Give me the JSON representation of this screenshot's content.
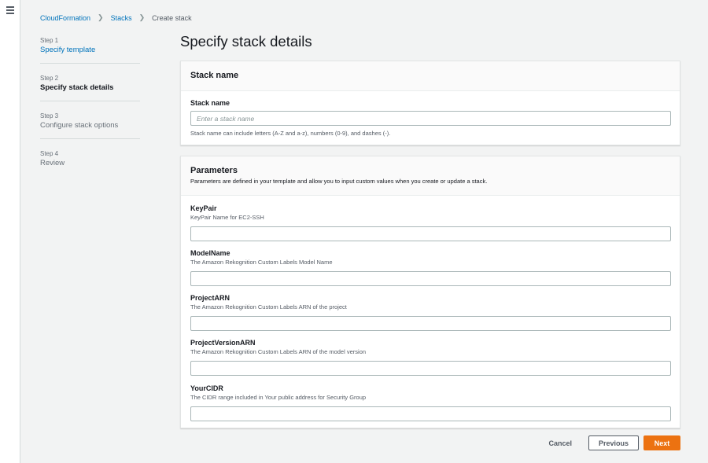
{
  "breadcrumb": {
    "items": [
      "CloudFormation",
      "Stacks"
    ],
    "current": "Create stack"
  },
  "steps": [
    {
      "num": "Step 1",
      "title": "Specify template"
    },
    {
      "num": "Step 2",
      "title": "Specify stack details"
    },
    {
      "num": "Step 3",
      "title": "Configure stack options"
    },
    {
      "num": "Step 4",
      "title": "Review"
    }
  ],
  "page_title": "Specify stack details",
  "stack_name_section": {
    "title": "Stack name",
    "field_label": "Stack name",
    "placeholder": "Enter a stack name",
    "value": "",
    "hint": "Stack name can include letters (A-Z and a-z), numbers (0-9), and dashes (-)."
  },
  "parameters_section": {
    "title": "Parameters",
    "description": "Parameters are defined in your template and allow you to input custom values when you create or update a stack.",
    "params": [
      {
        "label": "KeyPair",
        "description": "KeyPair Name for EC2-SSH",
        "value": ""
      },
      {
        "label": "ModelName",
        "description": "The Amazon Rekognition Custom Labels Model Name",
        "value": ""
      },
      {
        "label": "ProjectARN",
        "description": "The Amazon Rekognition Custom Labels ARN of the project",
        "value": ""
      },
      {
        "label": "ProjectVersionARN",
        "description": "The Amazon Rekognition Custom Labels ARN of the model version",
        "value": ""
      },
      {
        "label": "YourCIDR",
        "description": "The CIDR range included in Your public address for Security Group",
        "value": ""
      }
    ]
  },
  "footer": {
    "cancel_label": "Cancel",
    "previous_label": "Previous",
    "next_label": "Next"
  },
  "colors": {
    "link": "#0073bb",
    "primary_button": "#ec7211",
    "background": "#f2f3f3"
  },
  "icons": {
    "menu": "hamburger-menu-icon",
    "separator": "chevron-right-icon"
  }
}
